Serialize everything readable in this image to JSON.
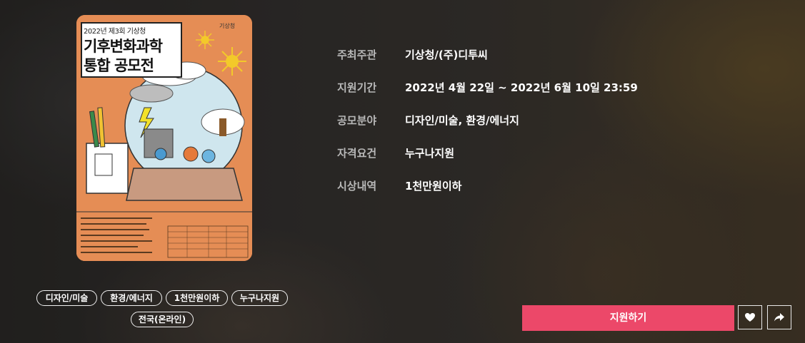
{
  "poster": {
    "logo_text": "기상청",
    "subtitle": "2022년 제3회 기상청",
    "title_line1": "기후변화과학",
    "title_line2": "통합 공모전"
  },
  "info": {
    "rows": [
      {
        "label": "주최주관",
        "value": "기상청/(주)디투씨"
      },
      {
        "label": "지원기간",
        "value": "2022년 4월 22일 ~ 2022년 6월 10일 23:59"
      },
      {
        "label": "공모분야",
        "value": "디자인/미술, 환경/에너지"
      },
      {
        "label": "자격요건",
        "value": "누구나지원"
      },
      {
        "label": "시상내역",
        "value": "1천만원이하"
      }
    ]
  },
  "tags": [
    "디자인/미술",
    "환경/에너지",
    "1천만원이하",
    "누구나지원",
    "전국(온라인)"
  ],
  "actions": {
    "apply_label": "지원하기",
    "like_icon": "heart-icon",
    "share_icon": "share-icon"
  },
  "colors": {
    "apply_button": "#ec4869",
    "poster_bg": "#e58d55"
  }
}
